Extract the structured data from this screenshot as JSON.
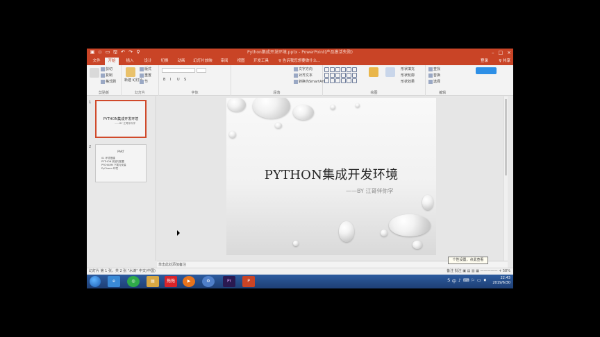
{
  "window": {
    "title": "Python集成开发环境.pptx - PowerPoint(产品激活失败)",
    "controls": [
      "–",
      "□",
      "×"
    ]
  },
  "qat": [
    "▣",
    "▫",
    "▭",
    "🖫",
    "↶",
    "↷",
    "⚲"
  ],
  "tabs": [
    {
      "label": "文件",
      "active": false
    },
    {
      "label": "开始",
      "active": true
    },
    {
      "label": "插入",
      "active": false
    },
    {
      "label": "设计",
      "active": false
    },
    {
      "label": "切换",
      "active": false
    },
    {
      "label": "动画",
      "active": false
    },
    {
      "label": "幻灯片放映",
      "active": false
    },
    {
      "label": "审阅",
      "active": false
    },
    {
      "label": "视图",
      "active": false
    },
    {
      "label": "开发工具",
      "active": false
    }
  ],
  "tell_me": "♀ 告诉我您想要做什么...",
  "sign_in": "登录",
  "share": "♀ 共享",
  "ribbon": {
    "clipboard": {
      "label": "剪贴板",
      "paste": "粘贴",
      "cut": "剪切",
      "copy": "复制",
      "format": "格式刷"
    },
    "slides": {
      "label": "幻灯片",
      "new": "新建\n幻灯片",
      "layout": "版式",
      "reset": "重置",
      "section": "节"
    },
    "font": {
      "label": "字体",
      "bold": "B",
      "italic": "I",
      "underline": "U",
      "s": "S"
    },
    "paragraph": {
      "label": "段落",
      "dir": "文字方向",
      "align": "对齐文本",
      "smart": "转换为SmartArt"
    },
    "drawing": {
      "label": "绘图",
      "arrange": "排列",
      "quick": "快速样式",
      "fill": "形状填充",
      "outline": "形状轮廓",
      "effects": "形状效果"
    },
    "editing": {
      "label": "编辑",
      "find": "查找",
      "replace": "替换",
      "select": "选择"
    }
  },
  "thumbnails": [
    {
      "num": "1",
      "title": "PYTHON集成开发环境",
      "sub": "——BY 江哥伴你学"
    },
    {
      "num": "2",
      "title": "PART",
      "lines": [
        "01 环境搭建",
        "PYTHON 安装与配置",
        "PYCHARM 下载与安装",
        "PyCharm 环境"
      ]
    }
  ],
  "slide": {
    "title": "PYTHON集成开发环境",
    "subtitle": "——BY   江哥伴你学"
  },
  "notes_placeholder": "单击此处添加备注",
  "status": {
    "left": "幻灯片 第 1 张，共 2 张   \"水滴\"   中文(中国)",
    "right": "备注  批注  ▣  ▤  ▥  ▦  —————  + 58%"
  },
  "tooltip": "个性设置，点此查看",
  "taskbar": {
    "apps": [
      "e",
      "◎",
      "▤",
      "拖拖",
      "▶",
      "⚙",
      "Pr",
      "P"
    ],
    "tray_icons": [
      "S",
      "中",
      "♪",
      "⌨",
      "⚐",
      "▭",
      "♦"
    ],
    "time": "22:43",
    "date": "2019/6/30"
  }
}
